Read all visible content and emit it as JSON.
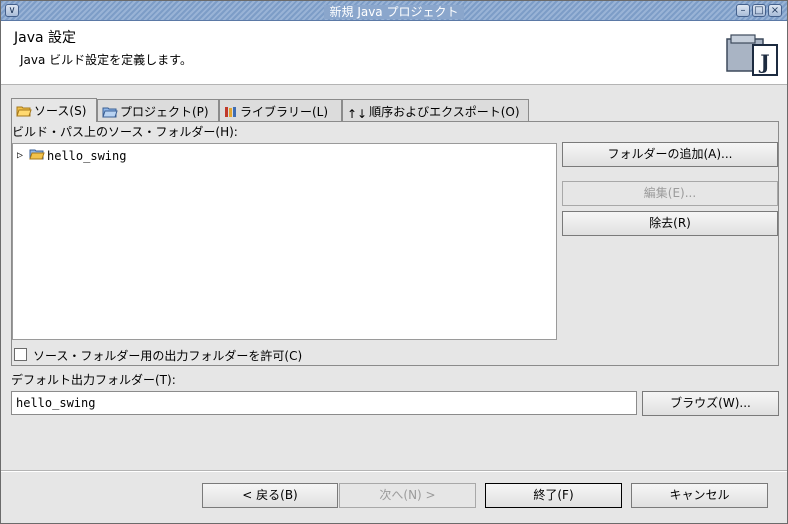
{
  "window": {
    "title": "新規 Java プロジェクト",
    "controls": [
      "minimize-icon",
      "maximize-icon",
      "close-icon"
    ]
  },
  "header": {
    "title": "Java 設定",
    "description": "Java ビルド設定を定義します。",
    "icon": "java-project-icon",
    "icon_letter": "J"
  },
  "tabs": [
    {
      "label": "ソース(S)",
      "icon": "folder-icon",
      "active": true
    },
    {
      "label": "プロジェクト(P)",
      "icon": "project-icon",
      "active": false
    },
    {
      "label": "ライブラリー(L)",
      "icon": "library-icon",
      "active": false
    },
    {
      "label": "順序およびエクスポート(O)",
      "icon": "order-icon",
      "active": false
    }
  ],
  "source": {
    "tree_label": "ビルド・パス上のソース・フォルダー(H):",
    "tree_items": [
      {
        "label": "hello_swing",
        "icon": "source-folder-icon",
        "expanded": false
      }
    ],
    "buttons": {
      "add_folder": "フォルダーの追加(A)...",
      "edit": "編集(E)...",
      "remove": "除去(R)"
    },
    "allow_output_checkbox": {
      "label": "ソース・フォルダー用の出力フォルダーを許可(C)",
      "checked": false
    }
  },
  "output": {
    "label": "デフォルト出力フォルダー(T):",
    "value": "hello_swing",
    "browse": "ブラウズ(W)..."
  },
  "footer": {
    "back": "< 戻る(B)",
    "next": "次へ(N) >",
    "finish": "終了(F)",
    "cancel": "キャンセル"
  }
}
